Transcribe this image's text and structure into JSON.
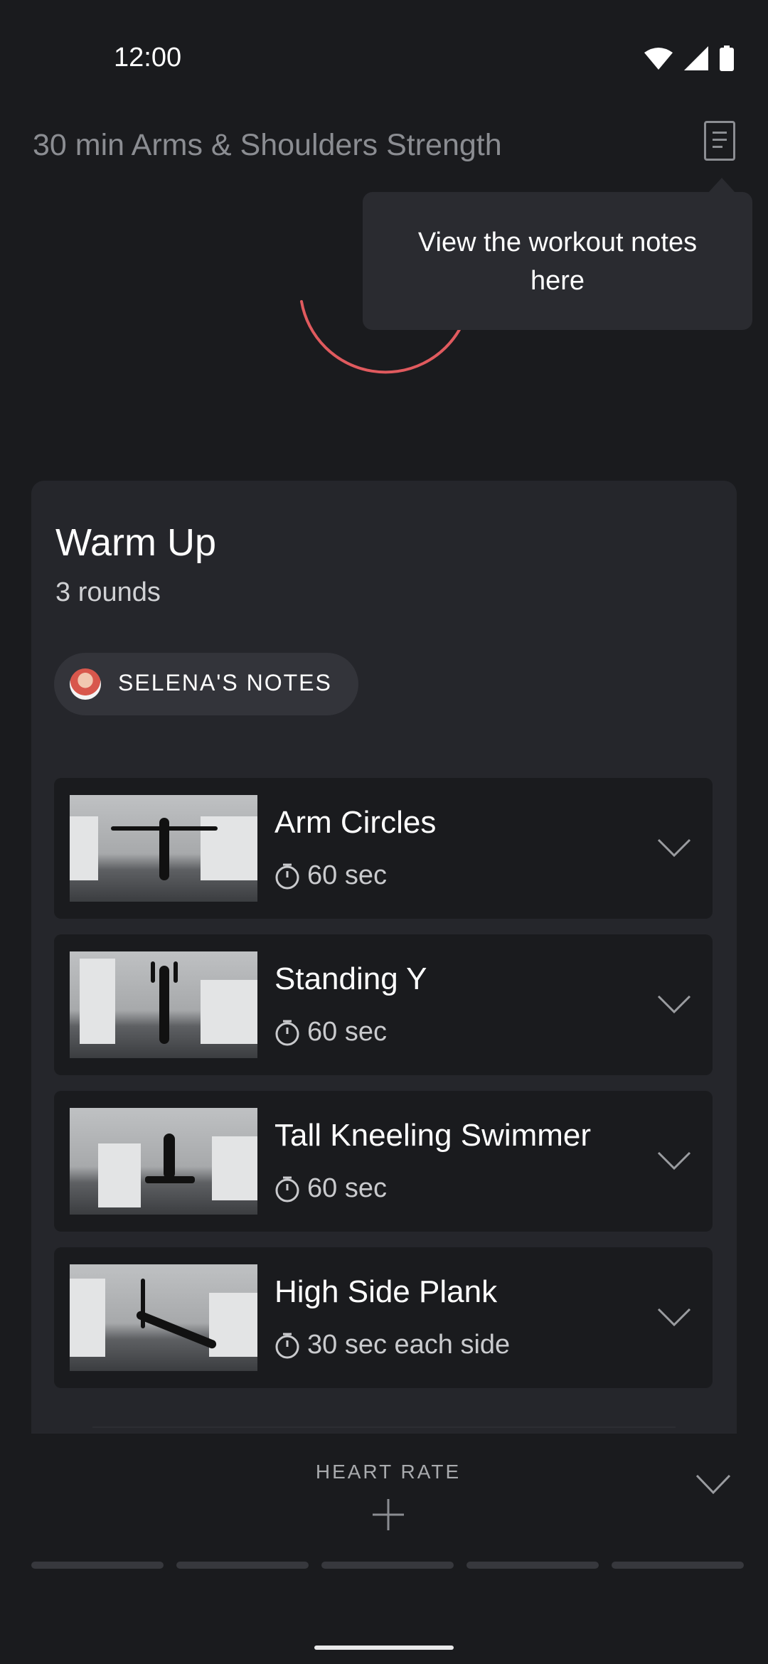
{
  "status_bar": {
    "time": "12:00"
  },
  "header": {
    "title": "30 min Arms & Shoulders Strength"
  },
  "tooltip": {
    "text": "View the workout notes here"
  },
  "section": {
    "title": "Warm Up",
    "subtitle": "3 rounds",
    "notes_label": "SELENA'S NOTES"
  },
  "exercises": [
    {
      "name": "Arm Circles",
      "duration": "60 sec"
    },
    {
      "name": "Standing Y",
      "duration": "60 sec"
    },
    {
      "name": "Tall Kneeling Swimmer",
      "duration": "60 sec"
    },
    {
      "name": "High Side Plank",
      "duration": "30 sec each side"
    }
  ],
  "footer": {
    "heart_rate_label": "HEART RATE"
  },
  "colors": {
    "background": "#1a1b1e",
    "card": "#25262b",
    "tooltip": "#2a2b30",
    "accent_arc": "#e05a5e"
  }
}
